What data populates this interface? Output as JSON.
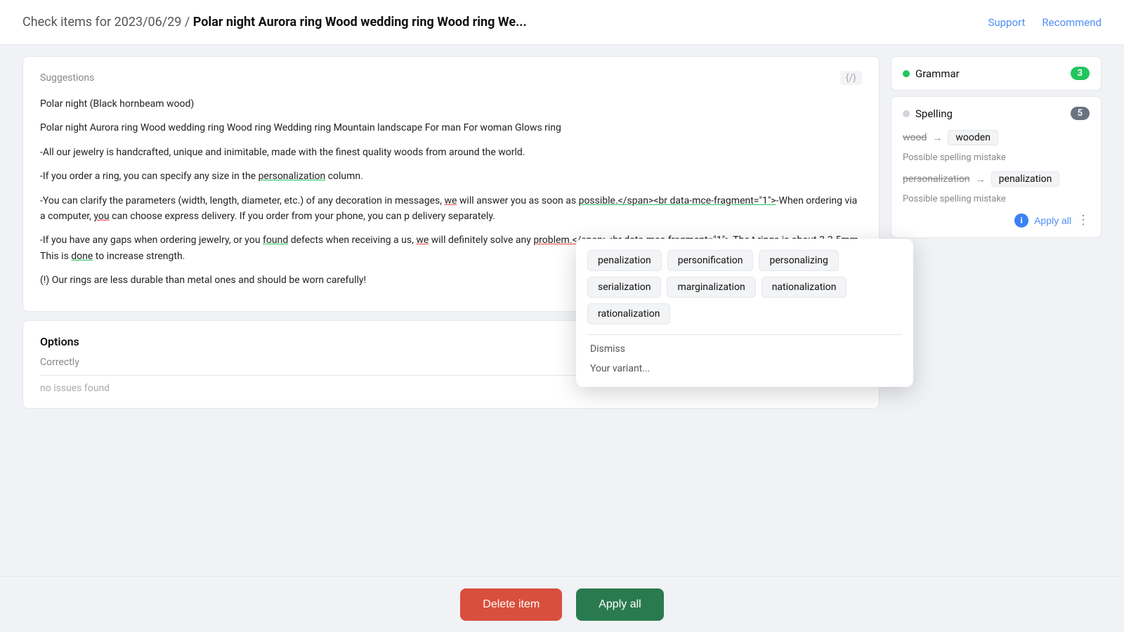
{
  "header": {
    "breadcrumb": "Check items for 2023/06/29",
    "separator": "/",
    "title": "Polar night Aurora ring Wood wedding ring Wood ring We...",
    "support_label": "Support",
    "recommend_label": "Recommend"
  },
  "suggestions": {
    "label": "Suggestions",
    "icon": "{/}",
    "line1": "Polar night (Black hornbeam wood)",
    "para1": "Polar night Aurora ring Wood wedding ring Wood ring Wedding ring Mountain landscape For man For woman Glows ring",
    "para2": "-All our jewelry is handcrafted, unique and inimitable, made with the finest quality woods from around the world.",
    "para3": "-If you order a ring, you can specify any size in the personalization column.",
    "para4": "-You can clarify the parameters (width, length, diameter, etc.) of any decoration in messages, we will answer you as soon as possible.</span><br data-mce-fragment=\"1\">-When ordering via a computer, you can choose express delivery. If you order from your phone, you can p delivery separately.",
    "para5": "-If you have any gaps when ordering jewelry, or you found defects when receiving a us, we will definitely solve any problem.</span><br data-mce-fragment=\"1\">-The t rings is about 3-3.5mm. This is done to increase strength.",
    "para6": "(!) Our rings are less durable than metal ones and should be worn carefully!"
  },
  "options": {
    "title": "Options",
    "correctly": "Correctly",
    "no_issues": "no issues found"
  },
  "right_panel": {
    "grammar_label": "Grammar",
    "grammar_count": "3",
    "spelling_label": "Spelling",
    "spelling_count": "5",
    "suggestion1": {
      "old": "wood",
      "new": "wooden",
      "mistake_text": "Possible spelling mistake"
    },
    "suggestion2": {
      "old": "personalization",
      "new": "penalization",
      "mistake_text": "Possible spelling mistake"
    },
    "apply_all_label": "Apply all",
    "info_icon": "i"
  },
  "dropdown": {
    "chips": [
      "penalization",
      "personification",
      "personalizing",
      "serialization",
      "marginalization",
      "nationalization",
      "rationalization"
    ],
    "dismiss": "Dismiss",
    "your_variant": "Your variant..."
  },
  "bottom_bar": {
    "delete_label": "Delete item",
    "apply_all_label": "Apply all"
  }
}
